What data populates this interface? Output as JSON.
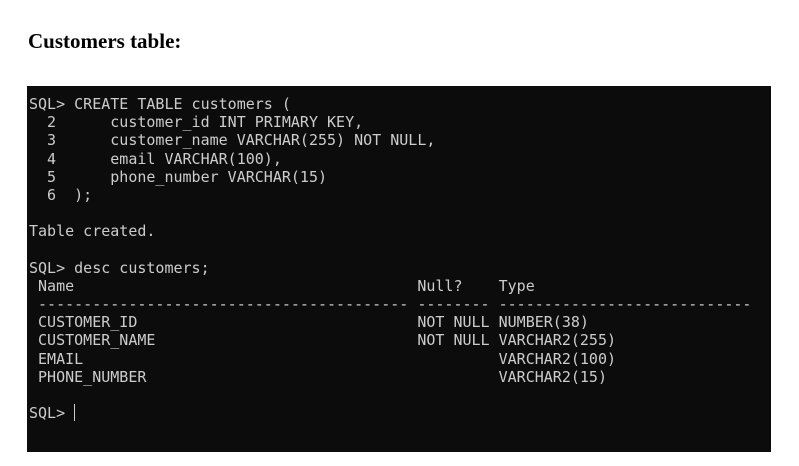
{
  "page": {
    "heading": "Customers table:"
  },
  "terminal": {
    "lines": [
      "SQL> CREATE TABLE customers (",
      "  2      customer_id INT PRIMARY KEY,",
      "  3      customer_name VARCHAR(255) NOT NULL,",
      "  4      email VARCHAR(100),",
      "  5      phone_number VARCHAR(15)",
      "  6  );",
      "",
      "Table created.",
      "",
      "SQL> desc customers;",
      " Name                                      Null?    Type",
      " ----------------------------------------- -------- ----------------------------",
      " CUSTOMER_ID                               NOT NULL NUMBER(38)",
      " CUSTOMER_NAME                             NOT NULL VARCHAR2(255)",
      " EMAIL                                              VARCHAR2(100)",
      " PHONE_NUMBER                                       VARCHAR2(15)",
      ""
    ],
    "final_prompt": "SQL>"
  }
}
